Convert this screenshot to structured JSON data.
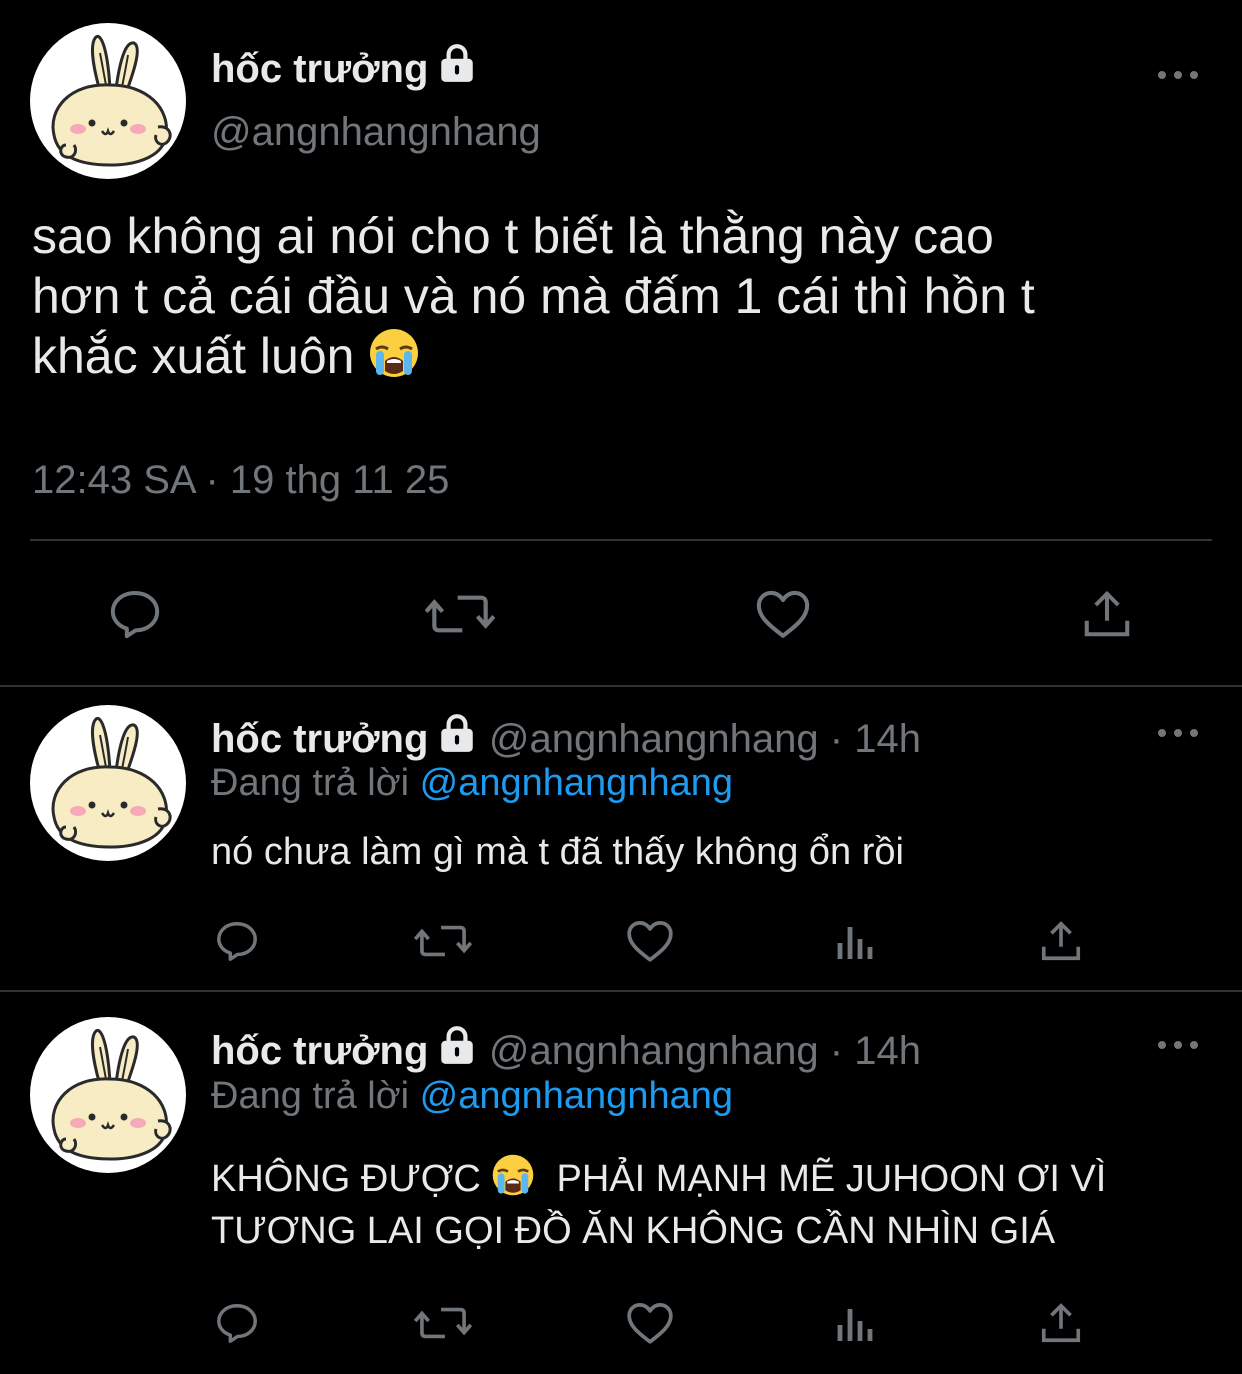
{
  "tweet": {
    "display_name": "hốc trưởng",
    "handle": "@angnhangnhang",
    "text_line1": "sao không ai nói cho t biết là thằng này cao",
    "text_line2": "hơn t cả cái đầu và nó mà đấm 1 cái thì hồn t",
    "text_line3": "khắc xuất luôn",
    "timestamp": "12:43 SA · 19 thg 11 25"
  },
  "replies": [
    {
      "display_name": "hốc trưởng",
      "handle_time": "@angnhangnhang · 14h",
      "replying_label": "Đang trả lời",
      "replying_to": "@angnhangnhang",
      "text_line1": "nó chưa làm gì mà t đã thấy không ổn rồi",
      "text_line2": ""
    },
    {
      "display_name": "hốc trưởng",
      "handle_time": "@angnhangnhang · 14h",
      "replying_label": "Đang trả lời",
      "replying_to": "@angnhangnhang",
      "text_line1a": "KHÔNG ĐƯỢC",
      "text_line1b": "PHẢI MẠNH MẼ JUHOON ƠI VÌ",
      "text_line2": "TƯƠNG LAI GỌI ĐỒ ĂN KHÔNG CẦN NHÌN GIÁ"
    }
  ],
  "icons": {
    "lock": "lock-icon",
    "more": "more-icon",
    "reply": "reply-icon",
    "retweet": "retweet-icon",
    "like": "heart-icon",
    "views": "analytics-icon",
    "share": "share-icon",
    "emoji": "loudly-crying-face-emoji"
  },
  "colors": {
    "background": "#000000",
    "text": "#e7e9ea",
    "secondary": "#71767b",
    "link": "#1d9bf0",
    "divider": "#2f3336"
  }
}
